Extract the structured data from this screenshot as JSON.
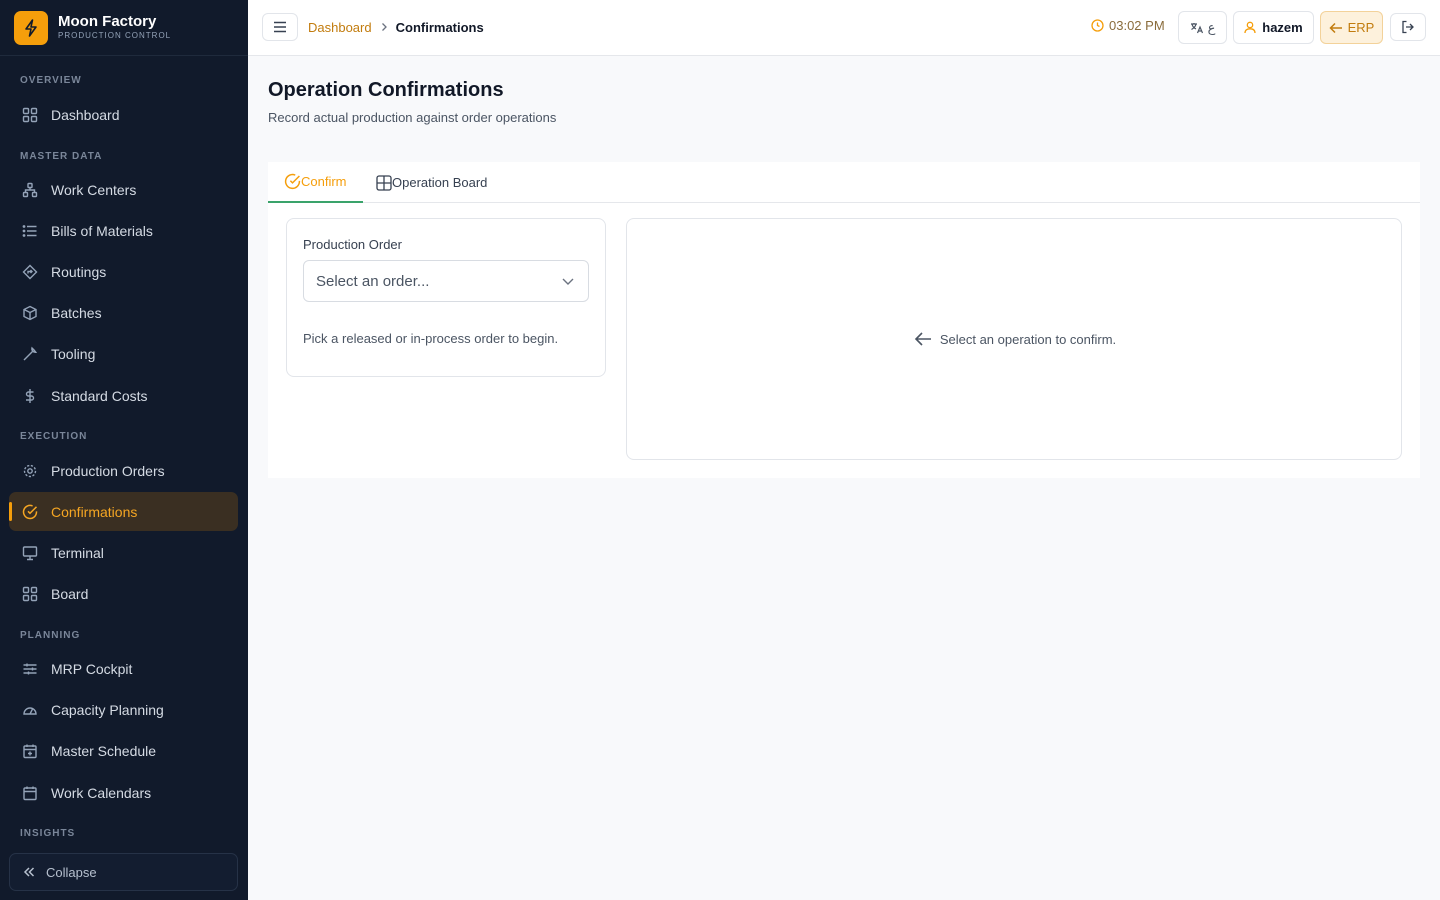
{
  "brand": {
    "name": "Moon Factory",
    "subtitle": "PRODUCTION CONTROL"
  },
  "sidebar": {
    "sections": {
      "overview": "OVERVIEW",
      "master_data": "MASTER DATA",
      "execution": "EXECUTION",
      "planning": "PLANNING",
      "insights": "INSIGHTS"
    },
    "items": {
      "dashboard": "Dashboard",
      "work_centers": "Work Centers",
      "bills_of_materials": "Bills of Materials",
      "routings": "Routings",
      "batches": "Batches",
      "tooling": "Tooling",
      "standard_costs": "Standard Costs",
      "production_orders": "Production Orders",
      "confirmations": "Confirmations",
      "terminal": "Terminal",
      "board": "Board",
      "mrp_cockpit": "MRP Cockpit",
      "capacity_planning": "Capacity Planning",
      "master_schedule": "Master Schedule",
      "work_calendars": "Work Calendars"
    },
    "active_item": "confirmations",
    "collapse_label": "Collapse"
  },
  "topbar": {
    "breadcrumb": {
      "parent": "Dashboard",
      "current": "Confirmations"
    },
    "time": "03:02 PM",
    "language_label": "ع",
    "user_name": "hazem",
    "erp_label": "ERP"
  },
  "page": {
    "title": "Operation Confirmations",
    "subtitle": "Record actual production against order operations"
  },
  "tabs": {
    "confirm": "Confirm",
    "operation_board": "Operation Board",
    "active": "confirm"
  },
  "order_card": {
    "label": "Production Order",
    "select_value": "Select an order...",
    "hint": "Pick a released or in-process order to begin."
  },
  "operation_panel": {
    "empty_message": "Select an operation to confirm."
  },
  "colors": {
    "accent": "#f59e0b",
    "sidebar_bg": "#111a2b",
    "active_tab_underline": "#3aa36b"
  }
}
